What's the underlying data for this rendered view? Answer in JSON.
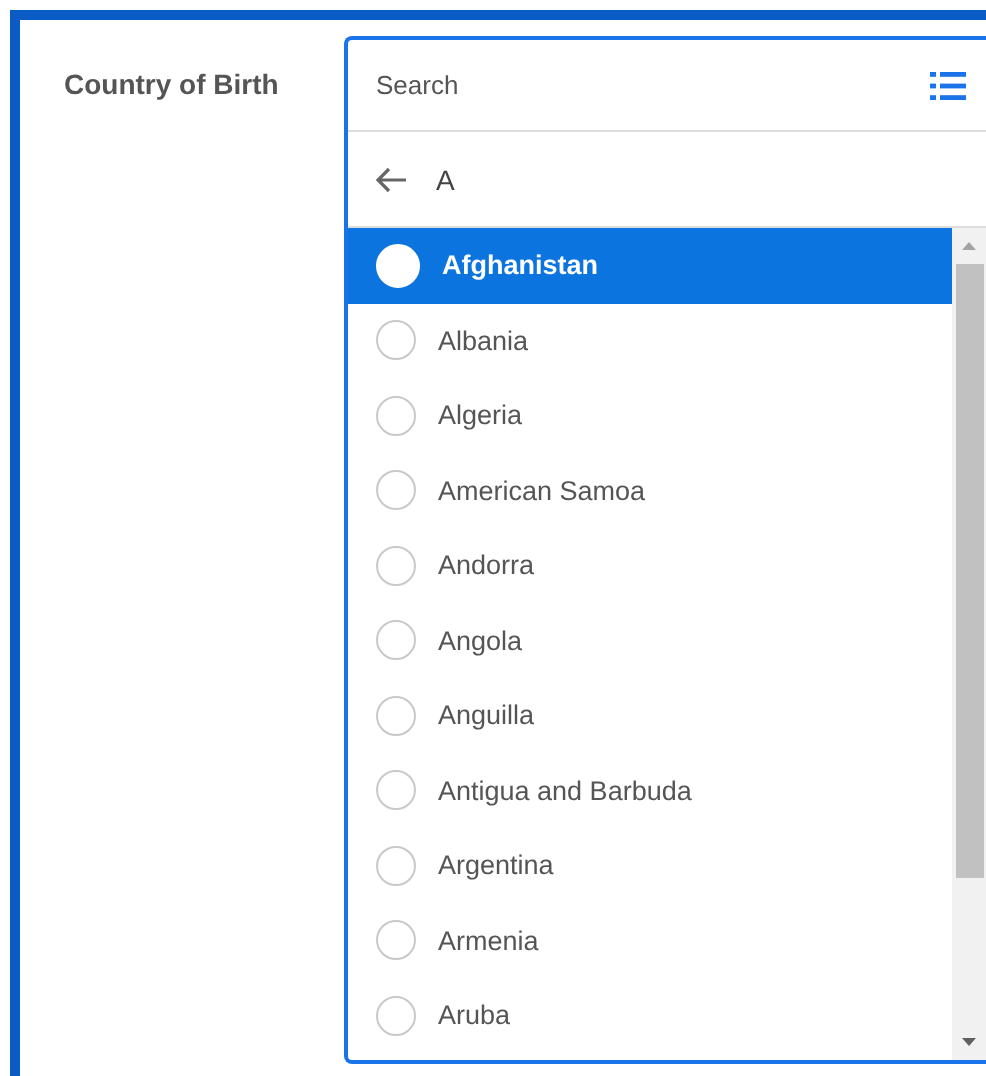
{
  "field": {
    "label": "Country of Birth"
  },
  "dropdown": {
    "search": {
      "placeholder": "Search"
    },
    "filter": {
      "text": "A"
    },
    "options": [
      {
        "name": "Afghanistan",
        "selected": true
      },
      {
        "name": "Albania",
        "selected": false
      },
      {
        "name": "Algeria",
        "selected": false
      },
      {
        "name": "American Samoa",
        "selected": false
      },
      {
        "name": "Andorra",
        "selected": false
      },
      {
        "name": "Angola",
        "selected": false
      },
      {
        "name": "Anguilla",
        "selected": false
      },
      {
        "name": "Antigua and Barbuda",
        "selected": false
      },
      {
        "name": "Argentina",
        "selected": false
      },
      {
        "name": "Armenia",
        "selected": false
      },
      {
        "name": "Aruba",
        "selected": false
      }
    ]
  }
}
